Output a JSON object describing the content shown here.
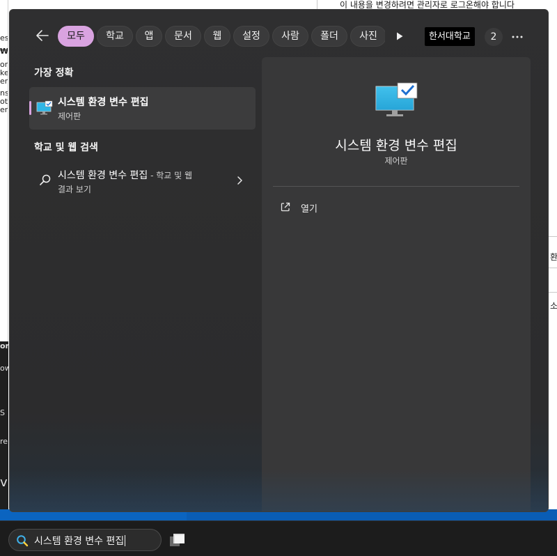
{
  "background": {
    "top_right_text": "이 내용을 변경하려면 관리자로 로그온해야 합니다",
    "left_fragments": [
      "es",
      "₩",
      "om",
      "ke",
      "er",
      "ns",
      "ot",
      "er"
    ],
    "left_dark_fragments": [
      "or",
      "ow",
      "S",
      "re",
      "vi"
    ],
    "right_fragments": [
      "환",
      "소"
    ]
  },
  "filters": {
    "back_label": "뒤로",
    "chips": [
      {
        "label": "모두",
        "active": true
      },
      {
        "label": "학교",
        "active": false
      },
      {
        "label": "앱",
        "active": false
      },
      {
        "label": "문서",
        "active": false
      },
      {
        "label": "웹",
        "active": false
      },
      {
        "label": "설정",
        "active": false
      },
      {
        "label": "사람",
        "active": false
      },
      {
        "label": "폴더",
        "active": false
      },
      {
        "label": "사진",
        "active": false
      }
    ],
    "org_name": "한서대학교",
    "points": "2"
  },
  "best_match": {
    "heading": "가장 정확",
    "title": "시스템 환경 변수 편집",
    "subtitle": "제어판"
  },
  "web_search": {
    "heading": "학교 및 웹 검색",
    "title": "시스템 환경 변수 편집",
    "suffix": " - 학교 및 웹",
    "line2": "결과 보기"
  },
  "detail": {
    "title": "시스템 환경 변수 편집",
    "category": "제어판",
    "actions": [
      {
        "label": "열기",
        "icon": "open-external-icon"
      }
    ]
  },
  "taskbar": {
    "search_query": "시스템 환경 변수 편집"
  },
  "colors": {
    "accent": "#d9a3e0",
    "panel": "#2f2f30",
    "pane": "#383839",
    "taskbar": "#1c1c1c"
  }
}
